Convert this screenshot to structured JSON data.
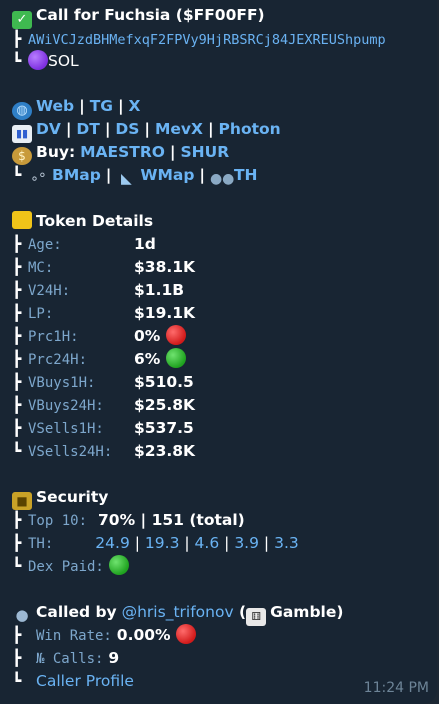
{
  "header": {
    "title": "Call for Fuchsia ($FF00FF)"
  },
  "contract": {
    "address": "AWiVCJzdBHMefxqF2FPVy9HjRBSRCj84JEXREUShpump",
    "chain": "SOL"
  },
  "links": {
    "row1": [
      "Web",
      "TG",
      "X"
    ],
    "row2": [
      "DV",
      "DT",
      "DS",
      "MevX",
      "Photon"
    ],
    "buy_label": "Buy:",
    "row3": [
      "MAESTRO",
      "SHUR"
    ],
    "row4": [
      "BMap",
      "WMap",
      "TH"
    ]
  },
  "token_details": {
    "title": "Token Details",
    "rows": [
      {
        "label": "Age:",
        "value": "1d"
      },
      {
        "label": "MC:",
        "value": "$38.1K"
      },
      {
        "label": "V24H:",
        "value": "$1.1B"
      },
      {
        "label": "LP:",
        "value": "$19.1K"
      },
      {
        "label": "Prc1H:",
        "value": "0%"
      },
      {
        "label": "Prc24H:",
        "value": "6%"
      },
      {
        "label": "VBuys1H:",
        "value": "$510.5"
      },
      {
        "label": "VBuys24H:",
        "value": "$25.8K"
      },
      {
        "label": "VSells1H:",
        "value": "$537.5"
      },
      {
        "label": "VSells24H:",
        "value": "$23.8K"
      }
    ]
  },
  "security": {
    "title": "Security",
    "top10_label": "Top 10:",
    "top10_value": "70% | 151 (total)",
    "th_label": "TH:",
    "th_values": [
      "24.9",
      "19.3",
      "4.6",
      "3.9",
      "3.3"
    ],
    "dex_label": "Dex Paid:"
  },
  "caller": {
    "prefix": "Called by",
    "handle": "@hris_trifonov",
    "tag": "Gamble",
    "winrate_label": "Win Rate:",
    "winrate_value": "0.00%",
    "calls_label": "№ Calls:",
    "calls_value": "9",
    "profile_link": "Caller Profile"
  },
  "timestamp": "11:24 PM",
  "colors": {
    "background": "#182533",
    "link": "#6ab3f3",
    "mono": "#7da7cc"
  }
}
